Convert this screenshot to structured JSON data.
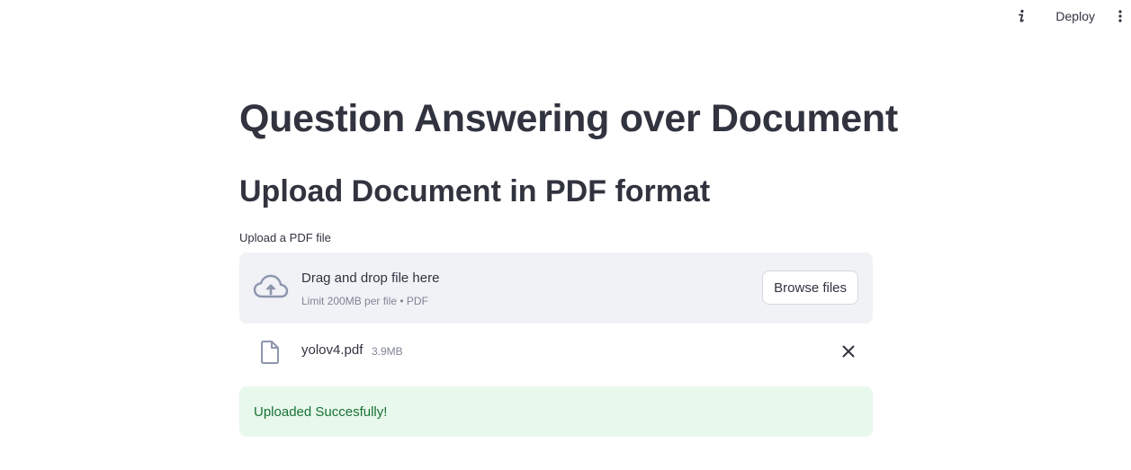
{
  "toolbar": {
    "info_icon": "info-icon",
    "deploy_label": "Deploy",
    "menu_icon": "vertical-dots-icon"
  },
  "main": {
    "title": "Question Answering over Document",
    "subtitle": "Upload Document in PDF format"
  },
  "uploader": {
    "label": "Upload a PDF file",
    "drop_text": "Drag and drop file here",
    "limit_text": "Limit 200MB per file • PDF",
    "browse_label": "Browse files",
    "icon": "cloud-upload-icon"
  },
  "file": {
    "name": "yolov4.pdf",
    "size": "3.9MB",
    "icon": "file-icon",
    "remove_icon": "close-icon"
  },
  "alert": {
    "message": "Uploaded Succesfully!",
    "background": "#e8f8ec",
    "text_color": "#177233"
  },
  "colors": {
    "text": "#31333f",
    "muted": "#808495",
    "dropzone_bg": "#f0f2f6"
  }
}
